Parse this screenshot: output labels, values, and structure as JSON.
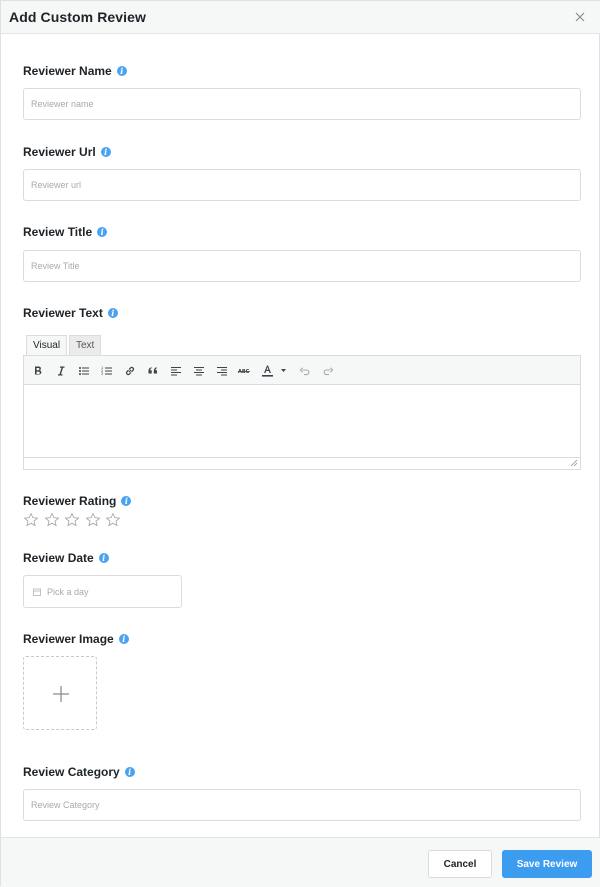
{
  "modal": {
    "title": "Add Custom Review"
  },
  "fields": {
    "reviewer_name": {
      "label": "Reviewer Name",
      "placeholder": "Reviewer name",
      "value": ""
    },
    "reviewer_url": {
      "label": "Reviewer Url",
      "placeholder": "Reviewer url",
      "value": ""
    },
    "review_title": {
      "label": "Review Title",
      "placeholder": "Review Title",
      "value": ""
    },
    "reviewer_text": {
      "label": "Reviewer Text",
      "tabs": [
        "Visual",
        "Text"
      ],
      "active_tab": "Visual",
      "value": ""
    },
    "reviewer_rating": {
      "label": "Reviewer Rating",
      "max_stars": 5,
      "rating": 0
    },
    "review_date": {
      "label": "Review Date",
      "placeholder": "Pick a day",
      "value": ""
    },
    "reviewer_image": {
      "label": "Reviewer Image"
    },
    "review_category": {
      "label": "Review Category",
      "placeholder": "Review Category",
      "value": ""
    }
  },
  "toolbar": {
    "buttons": [
      "bold-icon",
      "italic-icon",
      "bulleted-list-icon",
      "numbered-list-icon",
      "link-icon",
      "blockquote-icon",
      "align-left-icon",
      "align-center-icon",
      "align-right-icon",
      "strikethrough-icon",
      "text-color-icon",
      "undo-icon",
      "redo-icon"
    ]
  },
  "footer": {
    "cancel_label": "Cancel",
    "save_label": "Save Review"
  },
  "colors": {
    "accent": "#3b9cf0",
    "info_icon": "#4aa3f0"
  }
}
